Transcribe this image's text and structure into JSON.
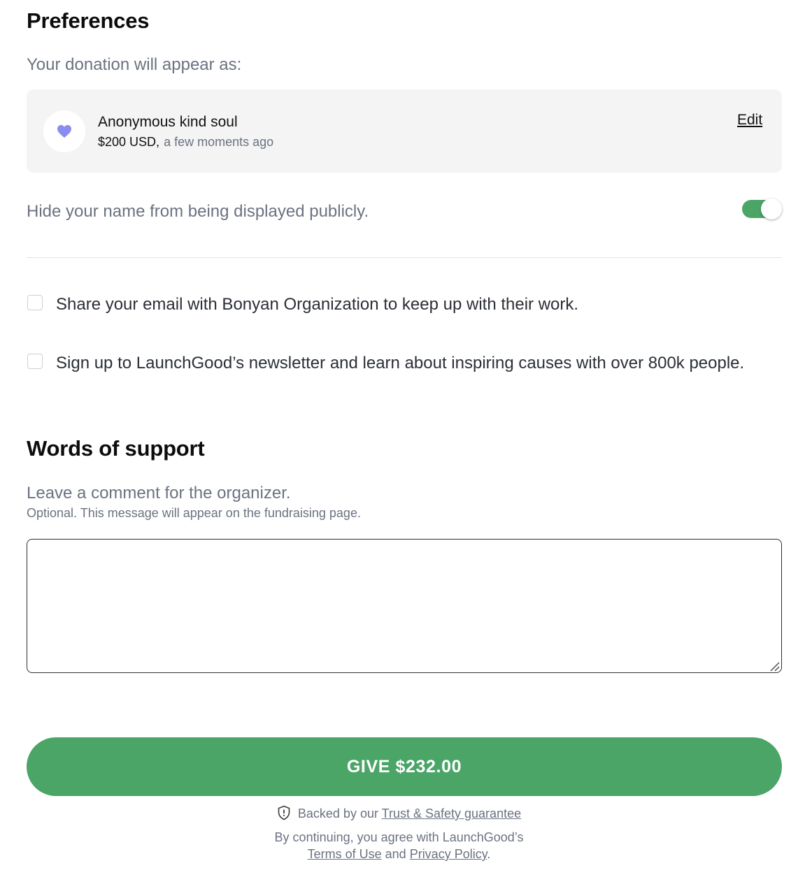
{
  "preferences": {
    "title": "Preferences",
    "appear_as_label": "Your donation will appear as:",
    "donor": {
      "name": "Anonymous kind soul",
      "amount": "$200 USD,",
      "time": "a few moments ago",
      "edit_label": "Edit",
      "avatar_icon": "heart-icon",
      "avatar_color": "#8b8cf0"
    },
    "hide_name": {
      "label": "Hide your name from being displayed publicly.",
      "enabled": true,
      "color": "#4aa567"
    },
    "options": [
      {
        "label": "Share your email with Bonyan Organization to keep up with their work.",
        "checked": false
      },
      {
        "label": "Sign up to LaunchGood’s newsletter and learn about inspiring causes with over 800k people.",
        "checked": false
      }
    ]
  },
  "support": {
    "title": "Words of support",
    "comment_label": "Leave a comment for the organizer.",
    "comment_hint": "Optional. This message will appear on the fundraising page.",
    "comment_value": ""
  },
  "cta": {
    "give_label": "GIVE $232.00",
    "color": "#4aa567"
  },
  "footer": {
    "backed_prefix": "Backed by our",
    "trust_link": "Trust & Safety guarantee",
    "agree_text": "By continuing, you agree with LaunchGood’s",
    "terms_link": "Terms of Use",
    "and_text": "and",
    "privacy_link": "Privacy Policy",
    "period": "."
  }
}
